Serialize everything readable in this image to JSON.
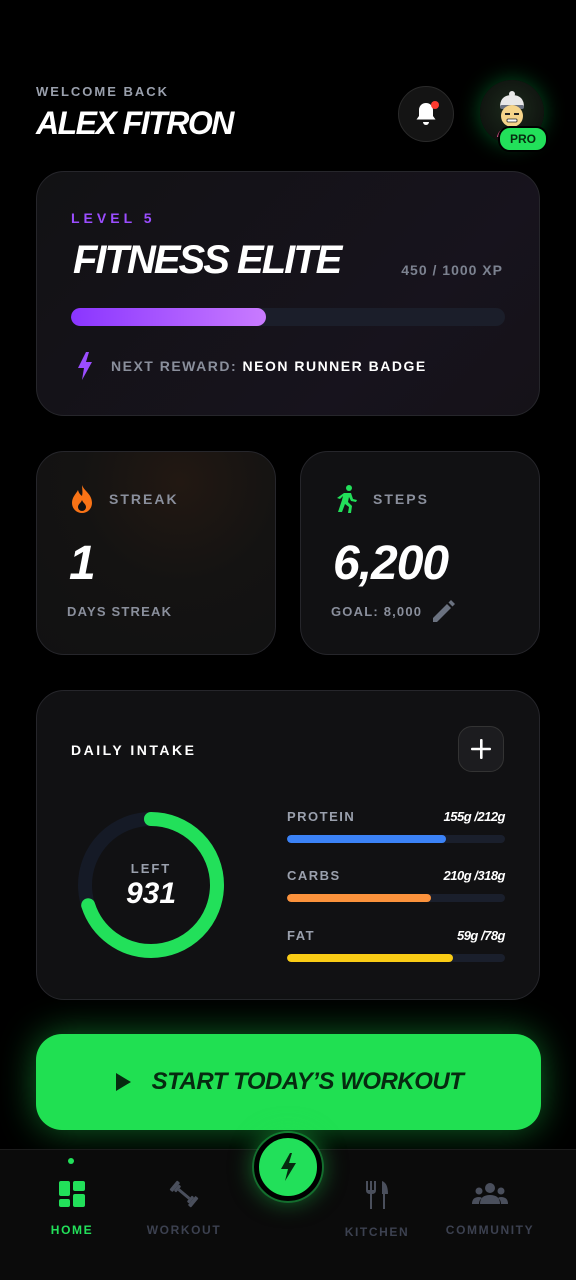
{
  "header": {
    "welcome": "WELCOME BACK",
    "username": "ALEX FITRON",
    "badge": "PRO",
    "avatar_icon": "avatar-icon",
    "bell_icon": "bell-icon"
  },
  "level": {
    "label": "LEVEL 5",
    "title": "FITNESS ELITE",
    "xp_text": "450 / 1000 XP",
    "xp_progress": 0.45,
    "reward_label": "NEXT REWARD:",
    "reward_value": "NEON RUNNER BADGE",
    "reward_icon": "lightning-icon"
  },
  "streak": {
    "label": "STREAK",
    "value": "1",
    "sub": "DAYS STREAK",
    "icon": "flame-icon"
  },
  "steps": {
    "label": "STEPS",
    "value": "6,200",
    "goal": "GOAL: 8,000",
    "icon": "runner-icon"
  },
  "intake": {
    "title": "DAILY INTAKE",
    "ring_label": "LEFT",
    "ring_value": "931",
    "ring_progress": 0.7,
    "macros": [
      {
        "name": "PROTEIN",
        "value": "155g /212g",
        "progress": 0.73,
        "color": "#3b82f6"
      },
      {
        "name": "CARBS",
        "value": "210g /318g",
        "progress": 0.66,
        "color": "#fb923c"
      },
      {
        "name": "FAT",
        "value": "59g /78g",
        "progress": 0.76,
        "color": "#facc15"
      }
    ]
  },
  "cta": {
    "label": "START TODAY’S WORKOUT",
    "icon": "play-icon"
  },
  "nav": {
    "items": [
      {
        "label": "HOME",
        "icon": "home-grid-icon",
        "active": true
      },
      {
        "label": "WORKOUT",
        "icon": "dumbbell-icon",
        "active": false
      },
      {
        "label": "KITCHEN",
        "icon": "utensils-icon",
        "active": false
      },
      {
        "label": "COMMUNITY",
        "icon": "people-icon",
        "active": false
      }
    ],
    "fab_icon": "lightning-icon"
  },
  "colors": {
    "accent_green": "#22e05a",
    "accent_purple": "#9b4dff",
    "background": "#000000"
  }
}
